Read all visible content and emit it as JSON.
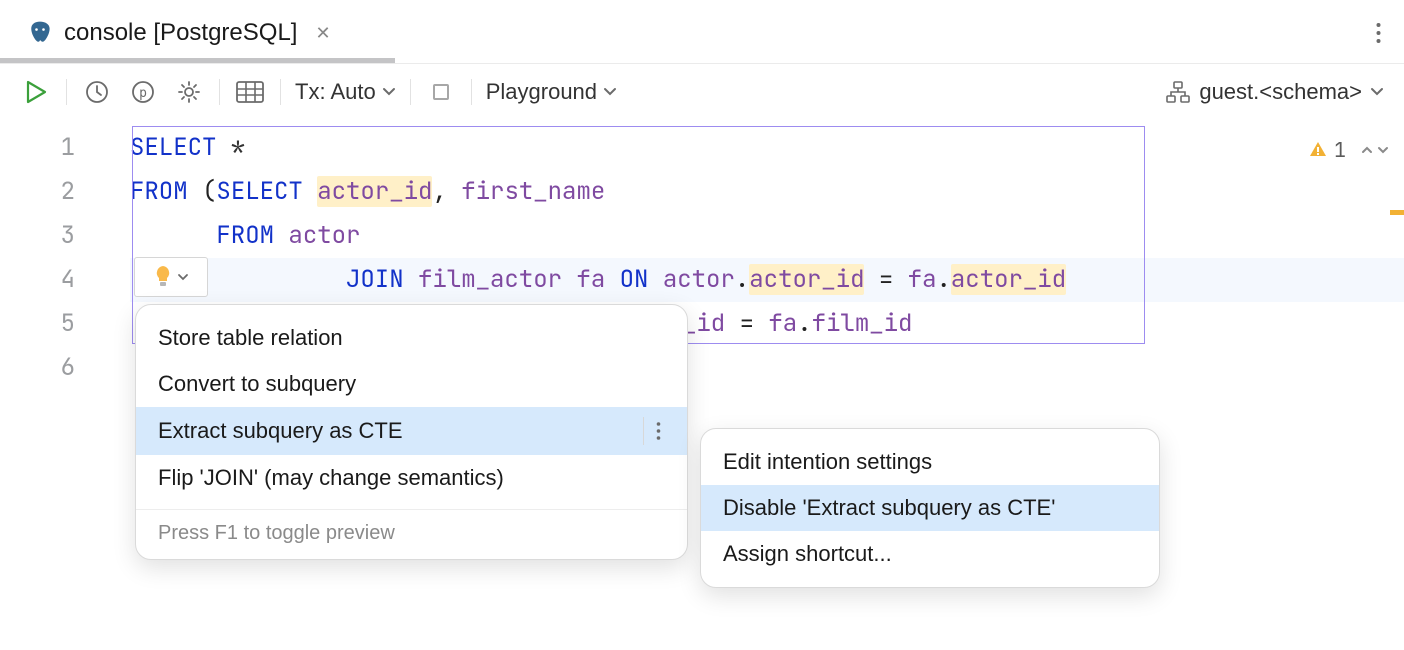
{
  "tab": {
    "title": "console [PostgreSQL]"
  },
  "toolbar": {
    "tx_label": "Tx: Auto",
    "session_label": "Playground",
    "schema_label": "guest.<schema>"
  },
  "gutter": [
    "1",
    "2",
    "3",
    "4",
    "5",
    "6"
  ],
  "code": {
    "l1_kw": "SELECT",
    "l1_star": " *",
    "l2_kw1": "FROM",
    "l2_paren": " (",
    "l2_kw2": "SELECT",
    "l2_sp": " ",
    "l2_id1": "actor_id",
    "l2_comma": ", ",
    "l2_id2": "first_name",
    "l3_pad": "      ",
    "l3_kw": "FROM",
    "l3_sp": " ",
    "l3_id": "actor",
    "l4_pad": "               ",
    "l4_kw1": "JOIN",
    "l4_sp1": " ",
    "l4_id1": "film_actor",
    "l4_sp2": " ",
    "l4_id2": "fa",
    "l4_sp3": " ",
    "l4_kw2": "ON",
    "l4_sp4": " ",
    "l4_id3": "actor",
    "l4_dot": ".",
    "l4_id4": "actor_id",
    "l4_eq": " = ",
    "l4_id5": "fa",
    "l4_dot2": ".",
    "l4_id6": "actor_id",
    "l5_tail_id1": "_id",
    "l5_eq": " = ",
    "l5_id2": "fa",
    "l5_dot": ".",
    "l5_id3": "film_id"
  },
  "intention_menu": {
    "items": [
      "Store table relation",
      "Convert to subquery",
      "Extract subquery as CTE",
      "Flip 'JOIN' (may change semantics)"
    ],
    "footer": "Press F1 to toggle preview"
  },
  "submenu": {
    "items": [
      "Edit intention settings",
      "Disable 'Extract subquery as CTE'",
      "Assign shortcut..."
    ]
  },
  "inspection": {
    "count": "1"
  }
}
